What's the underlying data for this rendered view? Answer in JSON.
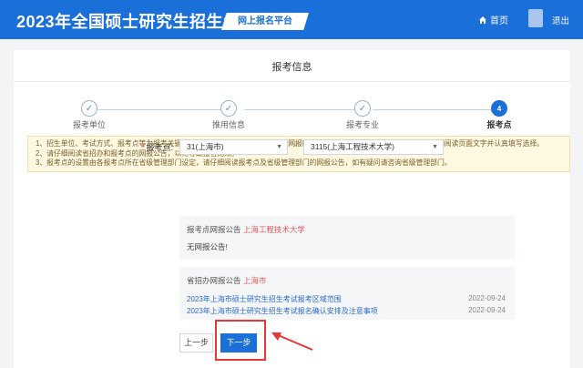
{
  "header": {
    "title": "2023年全国硕士研究生招生考试",
    "badge": "网上报名平台",
    "home_label": "首页",
    "logout_label": "退出"
  },
  "page": {
    "title": "报考信息"
  },
  "steps": [
    {
      "label": "报考单位",
      "state": "done"
    },
    {
      "label": "推用信息",
      "state": "done"
    },
    {
      "label": "报考专业",
      "state": "done"
    },
    {
      "label": "报考点",
      "number": "4",
      "state": "active"
    }
  ],
  "notice": [
    "1、招生单位、考试方式、报考点等为报考关键信息，在提交信息后不允许修改，网报时间结束后任何信息均不能修改，请考生仔细阅读页面文字并认真填写选择。",
    "2、请仔细阅读省招办和报考点的网报公告，以免导致报名无效。",
    "3、报考点的设置由各报考点所在省级管理部门设定，请仔细阅读报考点及省级管理部门的网报公告，如有疑问请咨询省级管理部门。"
  ],
  "form": {
    "label": "报考点:",
    "required_mark": "*",
    "province_value": "31(上海市)",
    "point_value": "3115(上海工程技术大学)"
  },
  "point_announcement": {
    "heading": "报考点网报公告",
    "school": "上海工程技术大学",
    "body": "无网报公告!"
  },
  "province_announcement": {
    "heading": "省招办网报公告",
    "province": "上海市",
    "items": [
      {
        "title": "2023年上海市硕士研究生招生考试报考区域范围",
        "date": "2022-09-24"
      },
      {
        "title": "2023年上海市硕士研究生招生考试报名确认安排及注意事项",
        "date": "2022-09-24"
      }
    ]
  },
  "buttons": {
    "prev": "上一步",
    "next": "下一步"
  },
  "colors": {
    "brand": "#1a6fd8",
    "highlight": "#e53935",
    "notice_bg": "#fff8e1"
  }
}
